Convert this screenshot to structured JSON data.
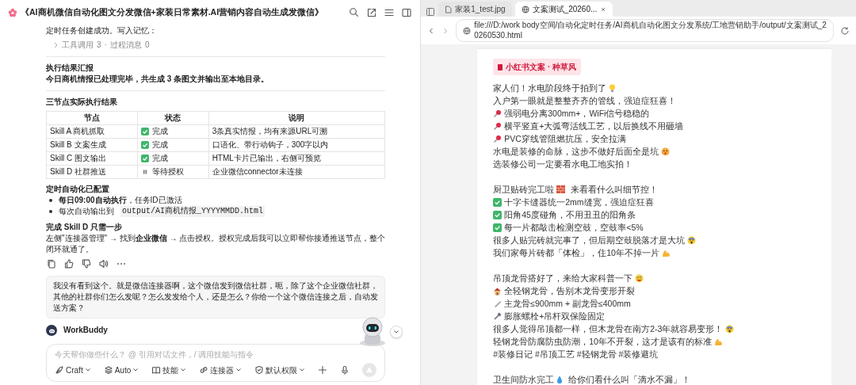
{
  "chat": {
    "title": "《AI商机微信自动化图文分发微信+家装日常素材.AI营销内容自动生成发微信》",
    "task_note": "定时任务创建成功。写入记忆：",
    "process_separator": "·",
    "process": [
      {
        "label": "工具调用",
        "count": "3"
      },
      {
        "label": "过程消息",
        "count": "0"
      }
    ],
    "report": {
      "heading": "执行结果汇报",
      "text": "今日商机情报已处理完毕，共生成 3 条图文并输出至本地目录。"
    },
    "table": {
      "heading": "三节点实际执行结果",
      "columns": [
        "节点",
        "状态",
        "说明"
      ],
      "rows": [
        {
          "node": "Skill A 商机抓取",
          "kind": "done",
          "status": "完成",
          "note": "3条真实情报，均有来源URL可溯"
        },
        {
          "node": "Skill B 文案生成",
          "kind": "done",
          "status": "完成",
          "note": "口语化、带行动钩子，300字以内"
        },
        {
          "node": "Skill C 图文输出",
          "kind": "done",
          "status": "完成",
          "note": "HTML卡片已输出，右侧可预览"
        },
        {
          "node": "Skill D 社群推送",
          "kind": "waiting",
          "status": "等待授权",
          "note": "企业微信connector未连接"
        }
      ]
    },
    "schedule": {
      "heading": "定时自动化已配置",
      "items": [
        {
          "text": "**每日09:00自动执行**，任务ID已激活"
        },
        {
          "text": "每次自动输出到",
          "code": "output/AI商机情报_YYYYMMDD.html"
        }
      ]
    },
    "next_step": {
      "heading": "完成 Skill D 只需一步",
      "text": "左侧\"连接器管理\" → 找到**企业微信** → 点击授权。授权完成后我可以立即帮你接通推送节点，整个闭环就通了。"
    },
    "user_message": "我没有看到这个。就是微信连接器啊，这个微信发到微信社群，呃，除了这个企业微信社群，其他的社群你们怎么发呢？怎么发发给个人，还是怎么？你给一个这个微信连接之后，自动发送方案？",
    "assistant_name": "WorkBuddy",
    "input_placeholder": "今天帮你做些什么？ @ 引用对话文件，/ 调用技能与指令",
    "toolbar": [
      {
        "kind": "craft",
        "label": "Craft"
      },
      {
        "kind": "auto",
        "label": "Auto"
      },
      {
        "kind": "skills",
        "label": "技能"
      },
      {
        "kind": "connector",
        "label": "连接器"
      },
      {
        "kind": "permission",
        "label": "默认权限"
      }
    ]
  },
  "browser": {
    "tabs": [
      {
        "label": "家装1_test.jpg",
        "kind": "file",
        "selected": false
      },
      {
        "label": "文案测试_20260...",
        "kind": "web",
        "selected": true
      }
    ],
    "url": "file:///D:/work body空间/自动化定时任务/AI商机自动化图文分发系统/工地营销助手/output/文案测试_20260530.html",
    "tag": "小红书文案 · 种草风",
    "lines": [
      {
        "kind": "bulb-trail",
        "text": "家人们！水电阶段终于拍到了"
      },
      {
        "kind": "plain",
        "text": "入户第一眼就是整整齐齐的管线，强迫症狂喜！"
      },
      {
        "kind": "pin-lead",
        "text": "强弱电分离300mm+，WiFi信号稳稳的"
      },
      {
        "kind": "pin-lead",
        "text": "横平竖直+大弧弯活线工艺，以后换线不用砸墙"
      },
      {
        "kind": "pin-lead",
        "text": "PVC穿线管阻燃抗压，安全拉满"
      },
      {
        "kind": "hot-trail",
        "text": "水电是装修的命脉，这步不做好后面全是坑"
      },
      {
        "kind": "plain",
        "text": "选装修公司一定要看水电工地实拍！"
      },
      {
        "kind": "blank"
      },
      {
        "kind": "brick-trail",
        "text": "厨卫贴砖完工啦",
        "after": "来看看什么叫细节控！"
      },
      {
        "kind": "check-lead",
        "text": "十字卡缝器统一2mm缝宽，强迫症狂喜"
      },
      {
        "kind": "check-lead",
        "text": "阳角45度碰角，不用丑丑的阳角条"
      },
      {
        "kind": "check-lead",
        "text": "每一片都敲击检测空鼓，空鼓率<5%"
      },
      {
        "kind": "scream-trail",
        "text": "很多人贴完砖就完事了，但后期空鼓脱落才是大坑"
      },
      {
        "kind": "muscle-trail",
        "text": "我们家每片砖都「体检」，住10年不掉一片"
      },
      {
        "kind": "blank"
      },
      {
        "kind": "grin-trail",
        "text": "吊顶龙骨搭好了，来给大家科普一下"
      },
      {
        "kind": "house-lead",
        "text": "全轻钢龙骨，告别木龙骨变形开裂"
      },
      {
        "kind": "ruler-lead",
        "text": "主龙骨≤900mm + 副龙骨≤400mm"
      },
      {
        "kind": "screw-lead",
        "text": "膨胀螺栓+吊杆双保险固定"
      },
      {
        "kind": "scream-trail",
        "text": "很多人觉得吊顶都一样，但木龙骨在南方2-3年就容易变形！"
      },
      {
        "kind": "muscle-trail",
        "text": "轻钢龙骨防腐防虫防潮，10年不开裂，这才是该有的标准"
      },
      {
        "kind": "plain",
        "text": "#装修日记 #吊顶工艺 #轻钢龙骨 #装修避坑"
      },
      {
        "kind": "blank"
      },
      {
        "kind": "drop-trail",
        "text": "卫生间防水完工",
        "after": "给你们看什么叫「滴水不漏」！"
      }
    ]
  }
}
